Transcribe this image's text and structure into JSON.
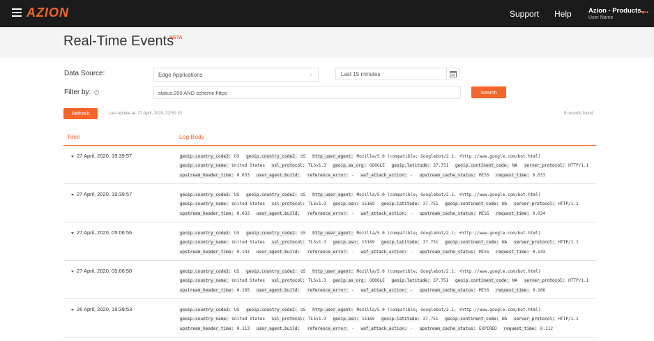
{
  "topbar": {
    "logo": "AZION",
    "links": [
      "Support",
      "Help"
    ],
    "user_title": "Azion - Products ...",
    "user_sub": "User Name"
  },
  "page": {
    "title": "Real-Time Events",
    "badge": "BETA"
  },
  "form": {
    "data_source_label": "Data Source:",
    "data_source_value": "Edge Applications",
    "date_range": "Last 15 minutes",
    "filter_label": "Filter by:",
    "filter_value": "status:200 AND scheme:https",
    "search_label": "Search",
    "refresh_label": "Refresh",
    "last_update": "Last update at: 27 April, 2020, 22:50:10",
    "records": "9 records found"
  },
  "table": {
    "headers": [
      "Time",
      "Log Body"
    ],
    "rows": [
      {
        "time": "27 April, 2020, 19:39:57",
        "fields": [
          [
            "geoip.country_code3:",
            "US"
          ],
          [
            "geoip.country_code2:",
            "US"
          ],
          [
            "http_user_agent:",
            "Mozilla/5.0 (compatible; Googlebot/2.1; +http://www.google.com/bot.html)"
          ],
          [
            "geoip.country_name:",
            "United States"
          ],
          [
            "ssl_protocol:",
            "TLSv1.3"
          ],
          [
            "geoip.as_org:",
            "GOOGLE"
          ],
          [
            "geoip.latitude:",
            "37.751"
          ],
          [
            "geoip.continent_code:",
            "NA"
          ],
          [
            "server_protocol:",
            "HTTP/1.1"
          ],
          [
            "upstream_header_time:",
            "0.033"
          ],
          [
            "user_agent.build:",
            ""
          ],
          [
            "reference_error:",
            "-"
          ],
          [
            "waf_attack_action:",
            "-"
          ],
          [
            "upstream_cache_status:",
            "MISS"
          ],
          [
            "request_time:",
            "0.033"
          ]
        ]
      },
      {
        "time": "27 April, 2020, 19:39:57",
        "fields": [
          [
            "geoip.country_code3:",
            "US"
          ],
          [
            "geoip.country_code2:",
            "US"
          ],
          [
            "http_user_agent:",
            "Mozilla/5.0 (compatible; Googlebot/2.1; +http://www.google.com/bot.html)"
          ],
          [
            "geoip.country_name:",
            "United States"
          ],
          [
            "ssl_protocol:",
            "TLSv1.3"
          ],
          [
            "geoip.asn:",
            "15169"
          ],
          [
            "geoip.latitude:",
            "37.751"
          ],
          [
            "geoip.continent_code:",
            "NA"
          ],
          [
            "server_protocol:",
            "HTTP/1.1"
          ],
          [
            "upstream_header_time:",
            "0.033"
          ],
          [
            "user_agent.build:",
            ""
          ],
          [
            "reference_error:",
            "-"
          ],
          [
            "waf_attack_action:",
            "-"
          ],
          [
            "upstream_cache_status:",
            "MISS"
          ],
          [
            "request_time:",
            "0.034"
          ]
        ]
      },
      {
        "time": "27 April, 2020, 05:06:56",
        "fields": [
          [
            "geoip.country_code3:",
            "US"
          ],
          [
            "geoip.country_code2:",
            "US"
          ],
          [
            "http_user_agent:",
            "Mozilla/5.0 (compatible; Googlebot/2.1; +http://www.google.com/bot.html)"
          ],
          [
            "geoip.country_name:",
            "United States"
          ],
          [
            "ssl_protocol:",
            "TLSv1.3"
          ],
          [
            "geoip.asn:",
            "15169"
          ],
          [
            "geoip.latitude:",
            "37.751"
          ],
          [
            "geoip.continent_code:",
            "NA"
          ],
          [
            "server_protocol:",
            "HTTP/1.1"
          ],
          [
            "upstream_header_time:",
            "0.143"
          ],
          [
            "user_agent.build:",
            ""
          ],
          [
            "reference_error:",
            "-"
          ],
          [
            "waf_attack_action:",
            "-"
          ],
          [
            "upstream_cache_status:",
            "MISS"
          ],
          [
            "request_time:",
            "0.143"
          ]
        ]
      },
      {
        "time": "27 April, 2020, 05:06:50",
        "fields": [
          [
            "geoip.country_code3:",
            "US"
          ],
          [
            "geoip.country_code2:",
            "US"
          ],
          [
            "http_user_agent:",
            "Mozilla/5.0 (compatible; Googlebot/2.1; +http://www.google.com/bot.html)"
          ],
          [
            "geoip.country_name:",
            "United States"
          ],
          [
            "ssl_protocol:",
            "TLSv1.3"
          ],
          [
            "geoip.as_org:",
            "GOOGLE"
          ],
          [
            "geoip.latitude:",
            "37.751"
          ],
          [
            "geoip.continent_code:",
            "NA"
          ],
          [
            "server_protocol:",
            "HTTP/1.1"
          ],
          [
            "upstream_header_time:",
            "0.165"
          ],
          [
            "user_agent.build:",
            ""
          ],
          [
            "reference_error:",
            "-"
          ],
          [
            "waf_attack_action:",
            "-"
          ],
          [
            "upstream_cache_status:",
            "MISS"
          ],
          [
            "request_time:",
            "0.166"
          ]
        ]
      },
      {
        "time": "26 April, 2020, 19:39:53",
        "fields": [
          [
            "geoip.country_code3:",
            "US"
          ],
          [
            "geoip.country_code2:",
            "US"
          ],
          [
            "http_user_agent:",
            "Mozilla/5.0 (compatible; Googlebot/2.1; +http://www.google.com/bot.html)"
          ],
          [
            "geoip.country_name:",
            "United States"
          ],
          [
            "ssl_protocol:",
            "TLSv1.3"
          ],
          [
            "geoip.asn:",
            "15169"
          ],
          [
            "geoip.latitude:",
            "37.751"
          ],
          [
            "geoip.continent_code:",
            "NA"
          ],
          [
            "server_protocol:",
            "HTTP/1.1"
          ],
          [
            "upstream_header_time:",
            "0.113"
          ],
          [
            "user_agent.build:",
            ""
          ],
          [
            "reference_error:",
            "-"
          ],
          [
            "waf_attack_action:",
            "-"
          ],
          [
            "upstream_cache_status:",
            "EXPIRED"
          ],
          [
            "request_time:",
            "0.112"
          ]
        ]
      }
    ]
  },
  "colors": {
    "accent": "#f3652b",
    "topbar": "#1b1b1b",
    "header_bg": "#f4f4f4"
  }
}
